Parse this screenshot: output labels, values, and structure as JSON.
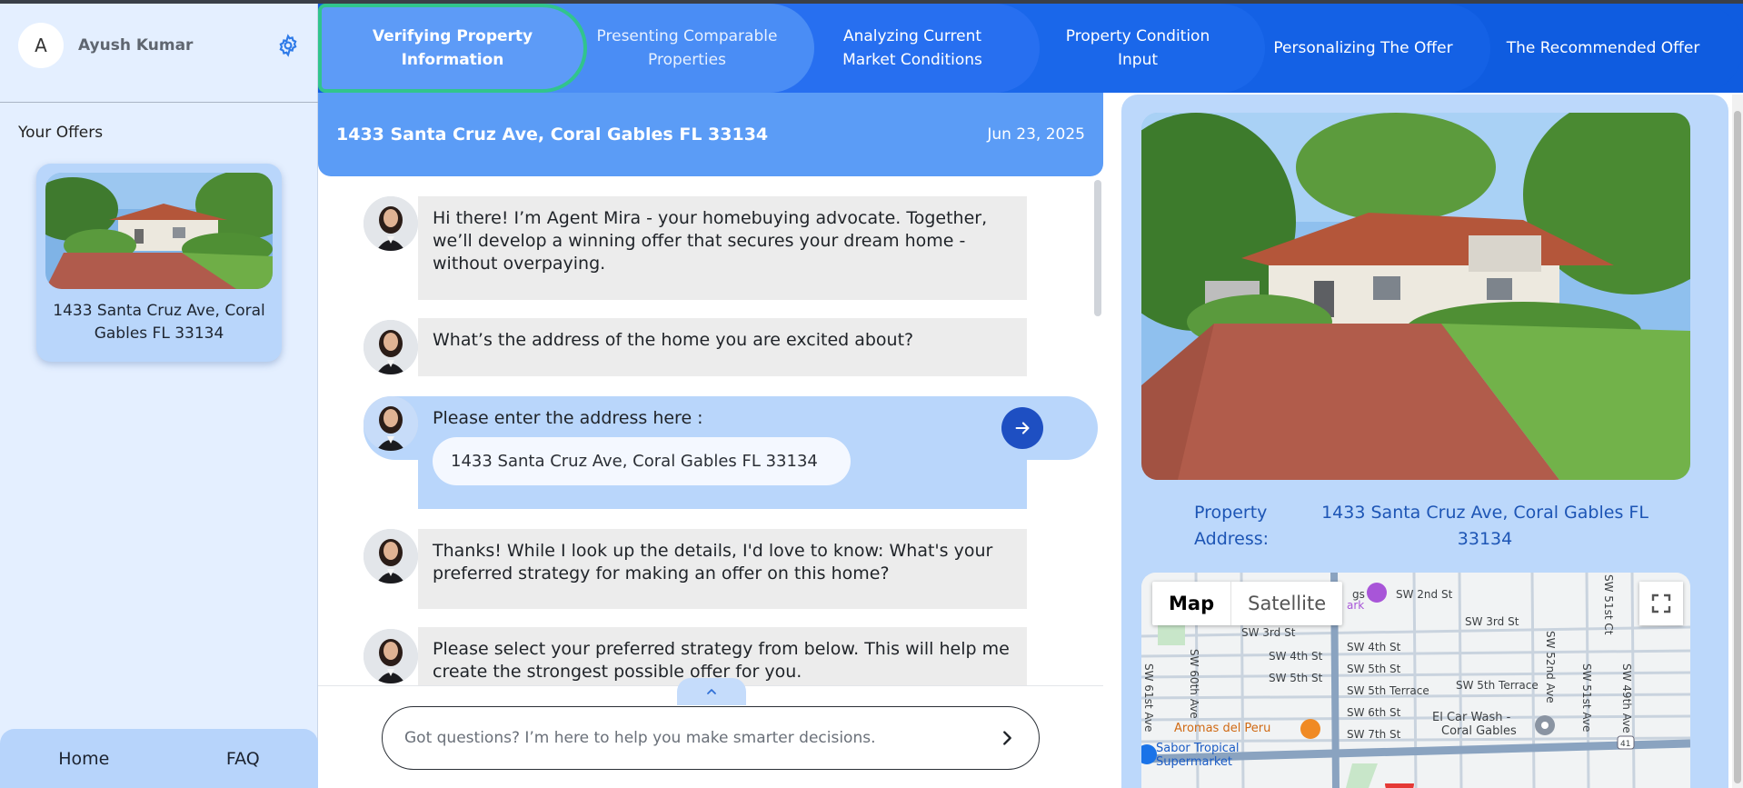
{
  "user": {
    "initial": "A",
    "name": "Ayush Kumar"
  },
  "sidebar": {
    "offers_title": "Your Offers",
    "offers": [
      {
        "address": "1433 Santa Cruz Ave, Coral Gables FL 33134"
      }
    ],
    "footer": {
      "home": "Home",
      "faq": "FAQ"
    }
  },
  "steps": [
    {
      "label": "Verifying Property Information",
      "active": true
    },
    {
      "label": "Presenting Comparable Properties"
    },
    {
      "label": "Analyzing Current Market Conditions"
    },
    {
      "label": "Property Condition Input"
    },
    {
      "label": "Personalizing The Offer"
    },
    {
      "label": "The Recommended Offer"
    }
  ],
  "chat": {
    "header_address": "1433 Santa Cruz Ave, Coral Gables FL 33134",
    "header_date": "Jun 23, 2025",
    "messages": [
      "Hi there! I’m Agent Mira - your homebuying advocate. Together, we’ll develop a winning offer that secures your dream home - without overpaying.",
      "What’s the address of the home you are excited about?",
      "Please enter the address here :",
      "Thanks! While I look up the details, I'd love to know: What's your preferred strategy for making an offer on this home?",
      "Please select your preferred strategy from below. This will help me create the strongest possible offer for you."
    ],
    "entered_address": "1433 Santa Cruz Ave, Coral Gables FL 33134",
    "input_placeholder": "Got questions? I’m here to help you make smarter decisions."
  },
  "property": {
    "label": "Property Address:",
    "address": "1433 Santa Cruz Ave, Coral Gables FL 33134"
  },
  "map": {
    "map_label": "Map",
    "satellite_label": "Satellite",
    "labels": {
      "sw2nd": "SW 2nd St",
      "sw3rd_a": "SW 3rd St",
      "sw3rd_b": "SW 3rd St",
      "sw4th_a": "SW 4th St",
      "sw4th_b": "SW 4th St",
      "sw5th_a": "SW 5th St",
      "sw5th_b": "SW 5th St",
      "sw5terr_a": "SW 5th Terrace",
      "sw5terr_b": "SW 5th Terrace",
      "sw6th": "SW 6th St",
      "sw7th": "SW 7th St",
      "sw60": "SW 60th Ave",
      "sw61": "SW 61st Ave",
      "sw52": "SW 52nd Ave",
      "sw51": "SW 51st Ave",
      "sw49": "SW 49th Ave",
      "sw51ct": "SW 51st Ct",
      "aromas": "Aromas del Peru",
      "sabor1": "Sabor Tropical",
      "sabor2": "Supermarket",
      "carwash1": "El Car Wash -",
      "carwash2": "Coral Gables",
      "park": "gs",
      "park2": "ark",
      "route": "41"
    }
  },
  "colors": {
    "accent": "#0f5ce0",
    "active_border": "#31c48d",
    "panel": "#bcd8fb",
    "sidebar": "#e4efff"
  }
}
